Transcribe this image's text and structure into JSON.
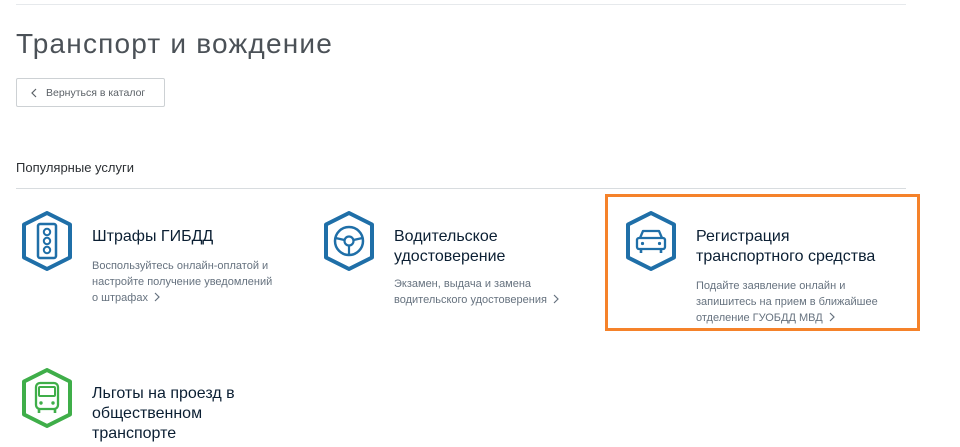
{
  "page": {
    "title": "Транспорт и вождение"
  },
  "back_button": {
    "label": "Вернуться в каталог"
  },
  "section": {
    "title": "Популярные услуги"
  },
  "services": [
    {
      "title_lines": [
        "Штрафы ГИБДД"
      ],
      "desc_lines": [
        "Воспользуйтесь онлайн-оплатой и",
        "настройте получение уведомлений",
        "о штрафах"
      ],
      "icon": "traffic-light-icon",
      "color": "#1f6fa8"
    },
    {
      "title_lines": [
        "Водительское",
        "удостоверение"
      ],
      "desc_lines": [
        "Экзамен, выдача и замена",
        "водительского удостоверения"
      ],
      "icon": "steering-wheel-icon",
      "color": "#1f6fa8"
    },
    {
      "title_lines": [
        "Регистрация",
        "транспортного средства"
      ],
      "desc_lines": [
        "Подайте заявление онлайн и",
        "запишитесь на прием в ближайшее",
        "отделение ГУОБДД МВД"
      ],
      "icon": "car-icon",
      "color": "#1f6fa8"
    },
    {
      "title_lines": [
        "Льготы на проезд в",
        "общественном",
        "транспорте"
      ],
      "desc_lines": [],
      "icon": "bus-icon",
      "color": "#3fae49"
    }
  ],
  "colors": {
    "accent": "#1f6fa8",
    "green": "#3fae49",
    "highlight": "#f5822a"
  }
}
